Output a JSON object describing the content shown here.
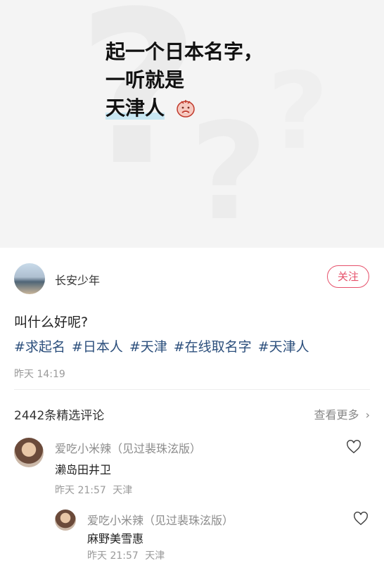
{
  "cover": {
    "line1": "起一个日本名字，",
    "line2": "一听就是",
    "line3": "天津人"
  },
  "author": {
    "name": "长安少年",
    "follow_label": "关注"
  },
  "post": {
    "question": "叫什么好呢?",
    "tags": [
      "#求起名",
      "#日本人",
      "#天津",
      "#在线取名字",
      "#天津人"
    ],
    "time": "昨天 14:19"
  },
  "comments_section": {
    "count_label": "2442条精选评论",
    "see_more": "查看更多"
  },
  "comments": [
    {
      "user": "爱吃小米辣（见过裴珠泫版）",
      "text": "濑岛田井卫",
      "time": "昨天 21:57",
      "location": "天津"
    },
    {
      "user": "爱吃小米辣（见过裴珠泫版）",
      "text": "麻野美雪惠",
      "time": "昨天 21:57",
      "location": "天津"
    }
  ],
  "colors": {
    "accent": "#e6506a",
    "tag": "#2c4f7c",
    "highlight": "#c9e7f3"
  }
}
